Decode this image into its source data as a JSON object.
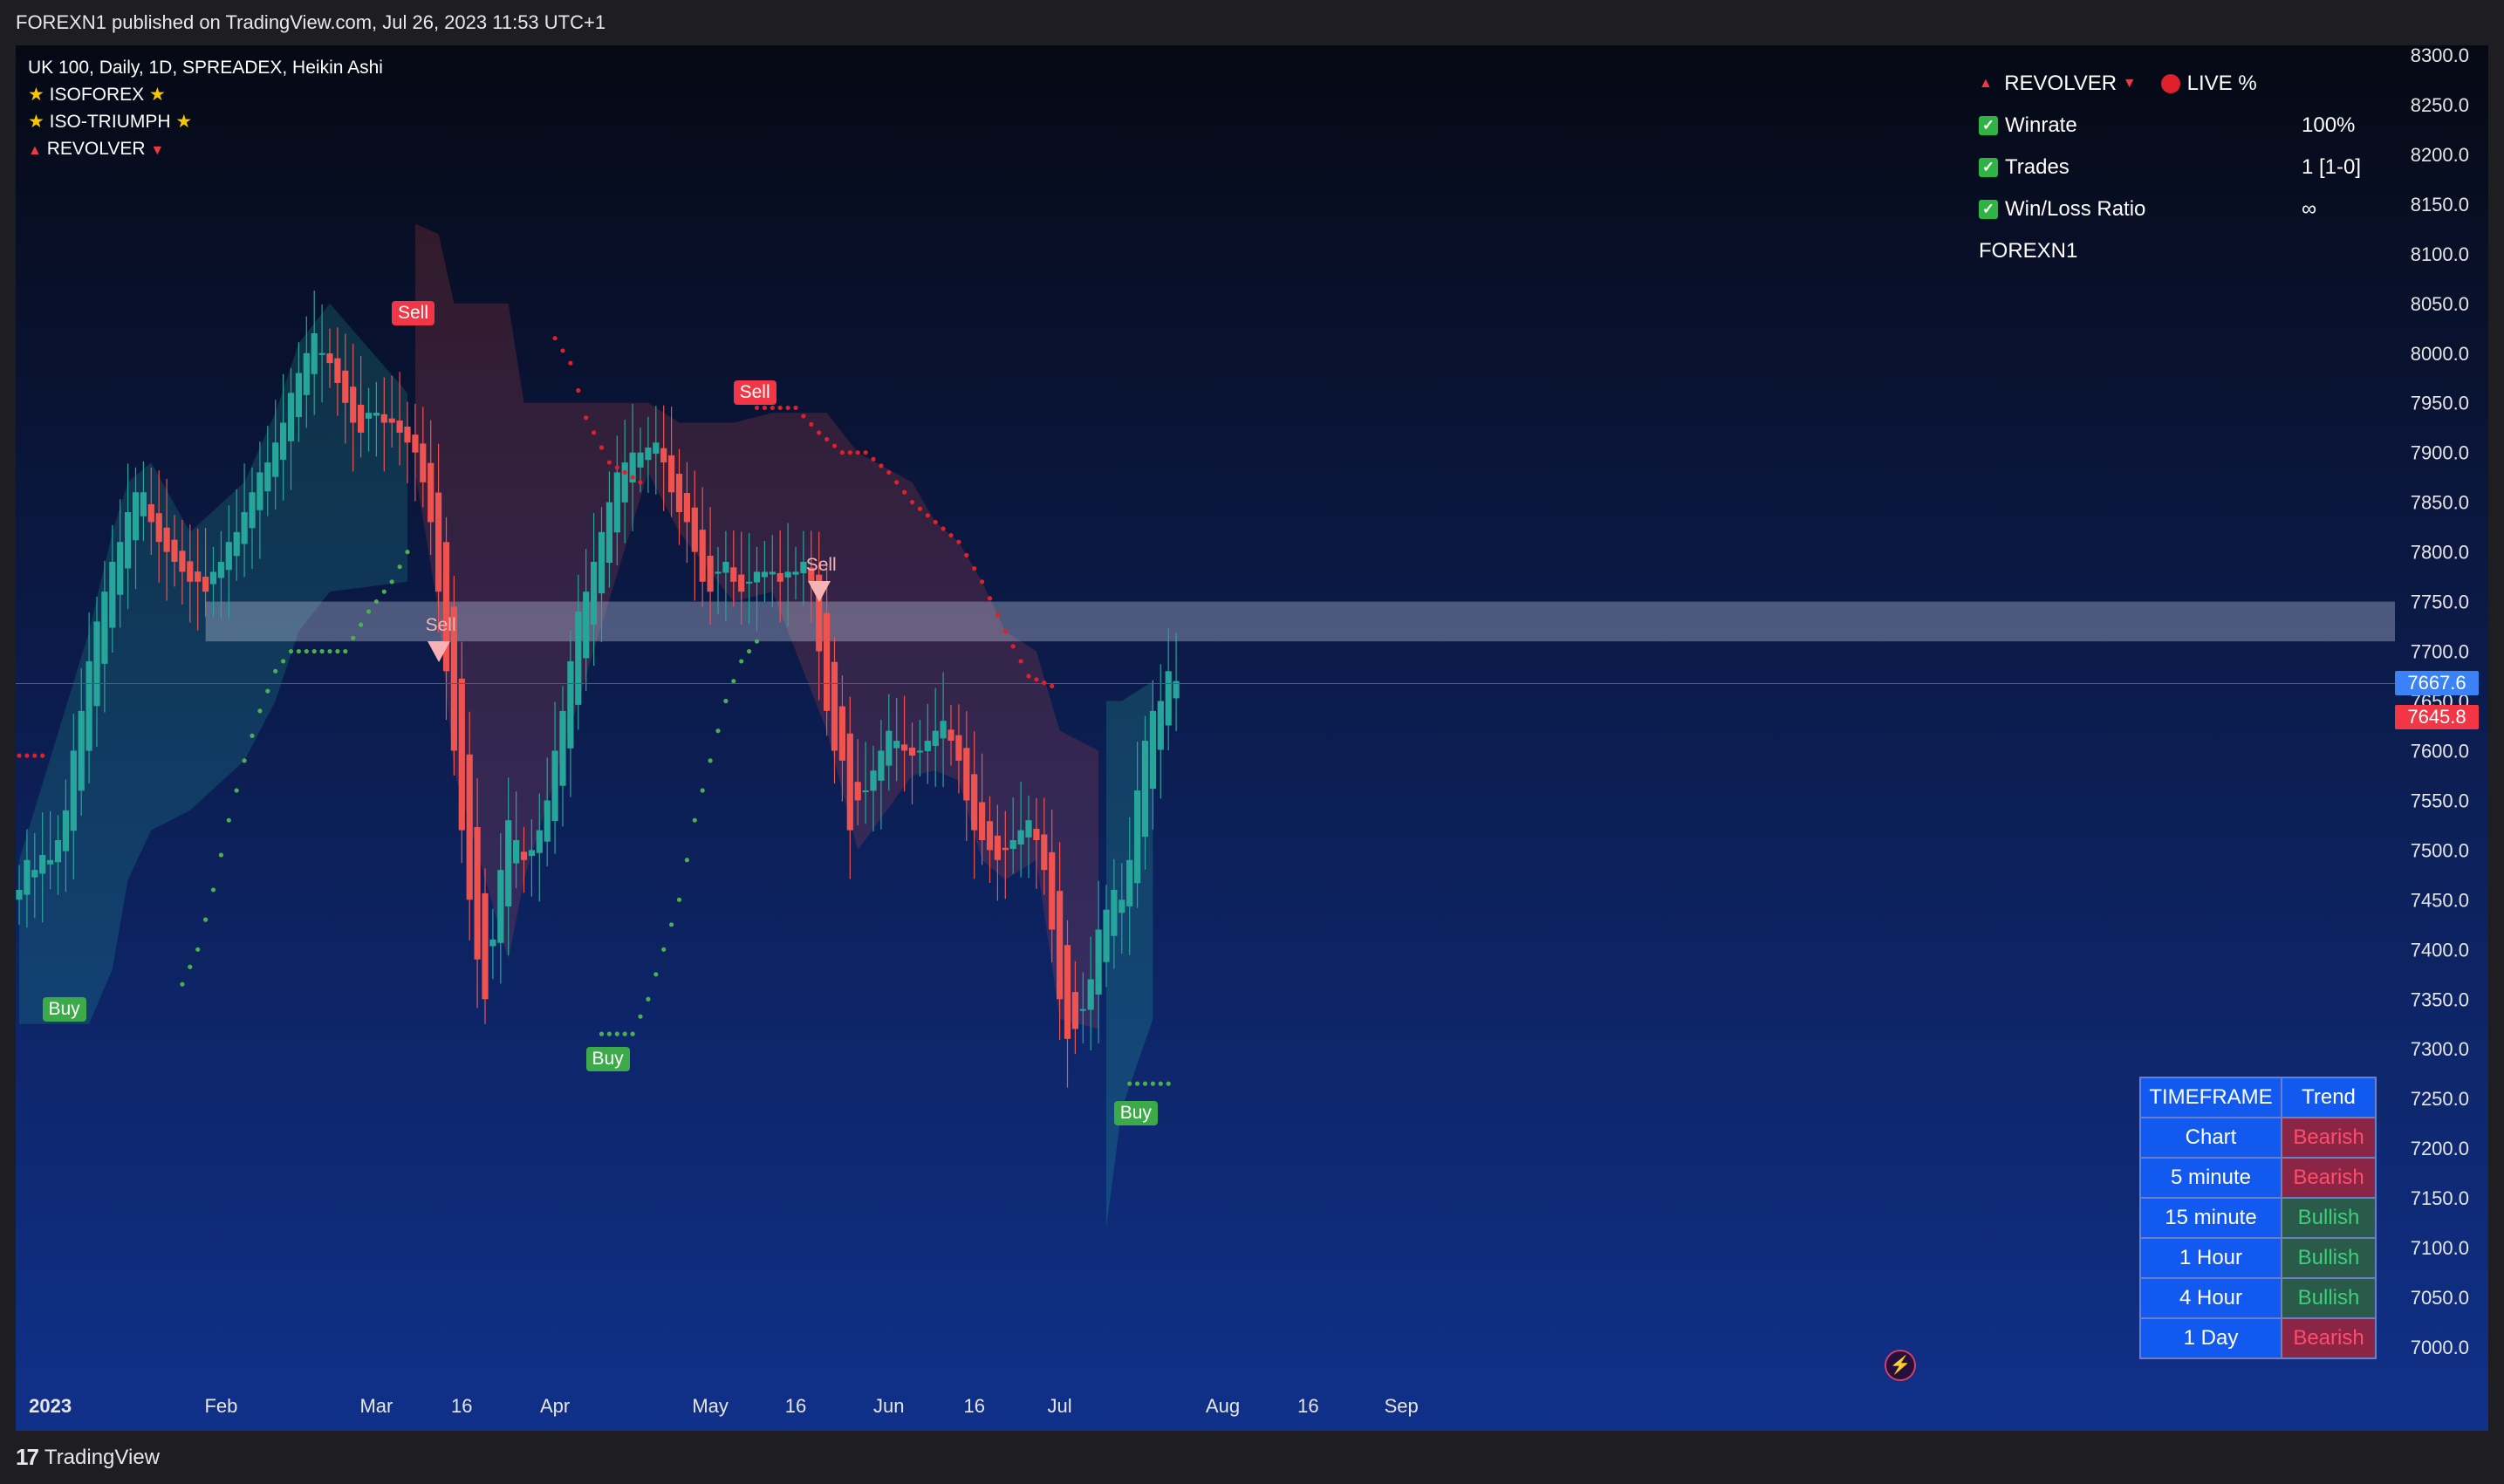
{
  "header": {
    "published": "FOREXN1 published on TradingView.com, Jul 26, 2023 11:53 UTC+1"
  },
  "footer": {
    "brand": "TradingView"
  },
  "legend": {
    "symbol": "UK 100, Daily, 1D, SPREADEX, Heikin Ashi",
    "indicator_1": "ISOFOREX",
    "indicator_2": "ISO-TRIUMPH",
    "indicator_3": "REVOLVER"
  },
  "stats_panel": {
    "title": "REVOLVER",
    "live_label": "LIVE %",
    "rows": [
      {
        "label": "Winrate",
        "value": "100%"
      },
      {
        "label": "Trades",
        "value": "1 [1-0]"
      },
      {
        "label": "Win/Loss Ratio",
        "value": "∞"
      }
    ],
    "author": "FOREXN1"
  },
  "trend_table": {
    "headers": [
      "TIMEFRAME",
      "Trend"
    ],
    "rows": [
      {
        "timeframe": "Chart",
        "trend": "Bearish"
      },
      {
        "timeframe": "5 minute",
        "trend": "Bearish"
      },
      {
        "timeframe": "15 minute",
        "trend": "Bullish"
      },
      {
        "timeframe": "1 Hour",
        "trend": "Bullish"
      },
      {
        "timeframe": "4 Hour",
        "trend": "Bullish"
      },
      {
        "timeframe": "1 Day",
        "trend": "Bearish"
      }
    ]
  },
  "price_tags": {
    "last": "7667.6",
    "stop": "7645.8"
  },
  "signals": {
    "sell": "Sell",
    "buy": "Buy"
  },
  "colors": {
    "bull": "#26a69a",
    "bear": "#ef5350",
    "bg_top": "#060914",
    "bg_bottom": "#0f2b7a",
    "stop_red": "#e0202a",
    "trail_green": "#4caf50"
  },
  "chart_data": {
    "type": "candlestick",
    "style": "Heikin Ashi",
    "symbol": "UK 100",
    "ylim": [
      7000,
      8300
    ],
    "y_ticks": [
      8300,
      8250,
      8200,
      8150,
      8100,
      8050,
      8000,
      7950,
      7900,
      7850,
      7800,
      7750,
      7700,
      7650,
      7600,
      7550,
      7500,
      7450,
      7400,
      7350,
      7300,
      7250,
      7200,
      7150,
      7100,
      7050,
      7000
    ],
    "x_ticks": [
      {
        "label": "2023",
        "i": 4
      },
      {
        "label": "Feb",
        "i": 26
      },
      {
        "label": "Mar",
        "i": 46
      },
      {
        "label": "16",
        "i": 57
      },
      {
        "label": "Apr",
        "i": 69
      },
      {
        "label": "May",
        "i": 89
      },
      {
        "label": "16",
        "i": 100
      },
      {
        "label": "Jun",
        "i": 112
      },
      {
        "label": "16",
        "i": 123
      },
      {
        "label": "Jul",
        "i": 134
      },
      {
        "label": "Aug",
        "i": 155
      },
      {
        "label": "16",
        "i": 166
      },
      {
        "label": "Sep",
        "i": 178
      }
    ],
    "close": [
      7460,
      7490,
      7480,
      7495,
      7490,
      7510,
      7540,
      7600,
      7640,
      7690,
      7730,
      7760,
      7790,
      7810,
      7840,
      7860,
      7860,
      7830,
      7810,
      7800,
      7790,
      7780,
      7770,
      7770,
      7760,
      7780,
      7790,
      7810,
      7820,
      7840,
      7860,
      7880,
      7890,
      7910,
      7930,
      7960,
      7980,
      8000,
      8020,
      8000,
      7990,
      7970,
      7950,
      7930,
      7920,
      7940,
      7940,
      7930,
      7930,
      7920,
      7910,
      7900,
      7870,
      7830,
      7760,
      7680,
      7600,
      7520,
      7450,
      7390,
      7350,
      7410,
      7480,
      7530,
      7510,
      7490,
      7500,
      7520,
      7550,
      7600,
      7640,
      7690,
      7740,
      7760,
      7790,
      7820,
      7850,
      7880,
      7890,
      7900,
      7900,
      7905,
      7910,
      7890,
      7860,
      7840,
      7830,
      7800,
      7770,
      7760,
      7780,
      7790,
      7770,
      7760,
      7770,
      7780,
      7780,
      7780,
      7770,
      7780,
      7780,
      7790,
      7770,
      7700,
      7640,
      7600,
      7590,
      7520,
      7550,
      7560,
      7580,
      7600,
      7620,
      7610,
      7600,
      7595,
      7600,
      7610,
      7620,
      7630,
      7610,
      7590,
      7550,
      7520,
      7510,
      7500,
      7490,
      7500,
      7510,
      7520,
      7530,
      7510,
      7480,
      7420,
      7350,
      7310,
      7320,
      7340,
      7370,
      7420,
      7440,
      7460,
      7450,
      7490,
      7560,
      7610,
      7640,
      7650,
      7680,
      7670
    ],
    "trail_stop": [
      {
        "i": 0,
        "v": 7595
      },
      {
        "i": 3,
        "v": 7595
      },
      {
        "i": 50,
        "v": 8015
      },
      {
        "i": 69,
        "v": 8015
      },
      {
        "i": 71,
        "v": 7990
      },
      {
        "i": 73,
        "v": 7935
      },
      {
        "i": 76,
        "v": 7890
      },
      {
        "i": 80,
        "v": 7870
      },
      {
        "i": 95,
        "v": 7945
      },
      {
        "i": 100,
        "v": 7945
      },
      {
        "i": 103,
        "v": 7920
      },
      {
        "i": 106,
        "v": 7900
      },
      {
        "i": 109,
        "v": 7900
      },
      {
        "i": 112,
        "v": 7880
      },
      {
        "i": 115,
        "v": 7850
      },
      {
        "i": 118,
        "v": 7830
      },
      {
        "i": 121,
        "v": 7810
      },
      {
        "i": 124,
        "v": 7770
      },
      {
        "i": 127,
        "v": 7720
      },
      {
        "i": 130,
        "v": 7675
      },
      {
        "i": 133,
        "v": 7665
      },
      {
        "i": 146,
        "v": 7665
      }
    ],
    "trail_support": [
      {
        "i": 5,
        "v": 7365
      },
      {
        "i": 21,
        "v": 7365
      },
      {
        "i": 23,
        "v": 7400
      },
      {
        "i": 25,
        "v": 7460
      },
      {
        "i": 27,
        "v": 7530
      },
      {
        "i": 29,
        "v": 7590
      },
      {
        "i": 31,
        "v": 7640
      },
      {
        "i": 33,
        "v": 7680
      },
      {
        "i": 35,
        "v": 7700
      },
      {
        "i": 42,
        "v": 7700
      },
      {
        "i": 45,
        "v": 7740
      },
      {
        "i": 48,
        "v": 7770
      },
      {
        "i": 50,
        "v": 7800
      },
      {
        "i": 75,
        "v": 7315
      },
      {
        "i": 79,
        "v": 7315
      },
      {
        "i": 81,
        "v": 7350
      },
      {
        "i": 83,
        "v": 7400
      },
      {
        "i": 85,
        "v": 7450
      },
      {
        "i": 87,
        "v": 7530
      },
      {
        "i": 89,
        "v": 7590
      },
      {
        "i": 91,
        "v": 7650
      },
      {
        "i": 93,
        "v": 7690
      },
      {
        "i": 95,
        "v": 7710
      },
      {
        "i": 143,
        "v": 7265
      },
      {
        "i": 148,
        "v": 7265
      }
    ],
    "cloud_bull": [
      {
        "i": 0,
        "v": 7325
      },
      {
        "i": 9,
        "v": 7325
      },
      {
        "i": 12,
        "v": 7380
      },
      {
        "i": 14,
        "v": 7470
      },
      {
        "i": 17,
        "v": 7520
      },
      {
        "i": 22,
        "v": 7540
      },
      {
        "i": 29,
        "v": 7590
      },
      {
        "i": 33,
        "v": 7650
      },
      {
        "i": 36,
        "v": 7720
      },
      {
        "i": 40,
        "v": 7760
      },
      {
        "i": 50,
        "v": 7770
      }
    ],
    "cloud_bear": [
      {
        "i": 51,
        "v": 8130
      },
      {
        "i": 54,
        "v": 8120
      },
      {
        "i": 56,
        "v": 8050
      },
      {
        "i": 63,
        "v": 8050
      },
      {
        "i": 65,
        "v": 7950
      },
      {
        "i": 81,
        "v": 7950
      },
      {
        "i": 85,
        "v": 7930
      },
      {
        "i": 92,
        "v": 7930
      },
      {
        "i": 97,
        "v": 7940
      },
      {
        "i": 104,
        "v": 7940
      },
      {
        "i": 108,
        "v": 7900
      },
      {
        "i": 115,
        "v": 7870
      },
      {
        "i": 118,
        "v": 7830
      },
      {
        "i": 121,
        "v": 7810
      },
      {
        "i": 124,
        "v": 7770
      },
      {
        "i": 127,
        "v": 7720
      },
      {
        "i": 131,
        "v": 7700
      },
      {
        "i": 134,
        "v": 7620
      },
      {
        "i": 139,
        "v": 7600
      }
    ],
    "cloud_bull_2": [
      {
        "i": 140,
        "v": 7120
      },
      {
        "i": 142,
        "v": 7240
      },
      {
        "i": 146,
        "v": 7330
      },
      {
        "i": 146,
        "v": 7650
      }
    ],
    "resistance_zone": [
      7710,
      7750
    ],
    "zone_start_i": 24,
    "signals": [
      {
        "type": "buy",
        "i": 5,
        "v": 7340
      },
      {
        "type": "sell",
        "i": 50,
        "v": 8040
      },
      {
        "type": "sell_arrow",
        "i": 54,
        "v": 7700
      },
      {
        "type": "buy",
        "i": 75,
        "v": 7290
      },
      {
        "type": "sell",
        "i": 94,
        "v": 7960
      },
      {
        "type": "sell_arrow",
        "i": 103,
        "v": 7760
      },
      {
        "type": "buy",
        "i": 143,
        "v": 7235
      }
    ],
    "last_price": 7667.6,
    "stop_price": 7645.8
  }
}
